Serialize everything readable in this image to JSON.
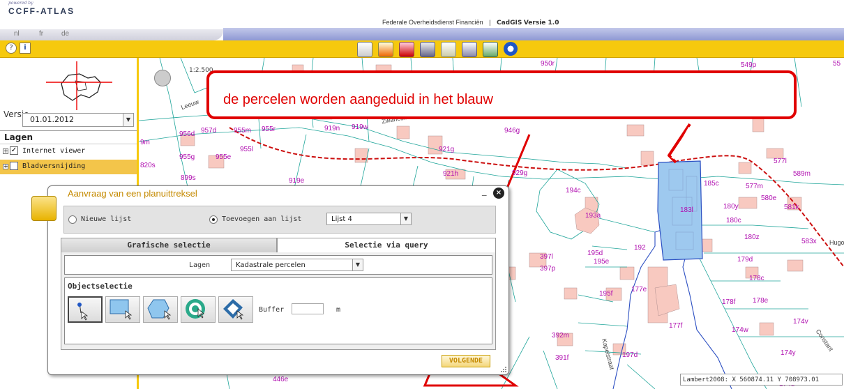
{
  "header": {
    "powered_by": "powered by",
    "logo": "CCFF-ATLAS",
    "title": "Federale Overheidsdienst Financiën",
    "app_name": "CadGIS",
    "version": "Versie 1.0",
    "separator": "|"
  },
  "languages": [
    "nl",
    "fr",
    "de"
  ],
  "toolbar": {
    "help_label": "?",
    "info_label": "i",
    "icons": [
      "layers-icon",
      "edit-icon",
      "measure-icon",
      "print-icon",
      "identify-icon",
      "search-parcel-icon",
      "search-address-icon",
      "info-icon"
    ]
  },
  "sidebar": {
    "versie_label": "Versie",
    "versie_value": "01.01.2012",
    "lagen_title": "Lagen",
    "layers": [
      {
        "label": "Internet viewer",
        "checked": true
      },
      {
        "label": "Bladversnijding",
        "checked": false
      }
    ]
  },
  "map": {
    "scale": "1:2.500",
    "parcels": [
      {
        "label": "956d"
      },
      {
        "label": "957d"
      },
      {
        "label": "955m"
      },
      {
        "label": "955r"
      },
      {
        "label": "919n"
      },
      {
        "label": "919w"
      },
      {
        "label": "946g"
      },
      {
        "label": "921g"
      },
      {
        "label": "921h"
      },
      {
        "label": "929g"
      },
      {
        "label": "955g"
      },
      {
        "label": "955e"
      },
      {
        "label": "955l"
      },
      {
        "label": "820s"
      },
      {
        "label": "899s"
      },
      {
        "label": "9m"
      },
      {
        "label": "919e"
      },
      {
        "label": "950r"
      },
      {
        "label": "549p"
      },
      {
        "label": "55"
      },
      {
        "label": "185c"
      },
      {
        "label": "194c"
      },
      {
        "label": "193a"
      },
      {
        "label": "183l"
      },
      {
        "label": "180y"
      },
      {
        "label": "180c"
      },
      {
        "label": "180z"
      },
      {
        "label": "577l"
      },
      {
        "label": "577m"
      },
      {
        "label": "589m"
      },
      {
        "label": "580e"
      },
      {
        "label": "581k"
      },
      {
        "label": "583x"
      },
      {
        "label": "195d"
      },
      {
        "label": "195e"
      },
      {
        "label": "192"
      },
      {
        "label": "397l"
      },
      {
        "label": "397p"
      },
      {
        "label": "179d"
      },
      {
        "label": "178c"
      },
      {
        "label": "195f"
      },
      {
        "label": "177e"
      },
      {
        "label": "178f"
      },
      {
        "label": "178e"
      },
      {
        "label": "174v"
      },
      {
        "label": "177f"
      },
      {
        "label": "174w"
      },
      {
        "label": "392m"
      },
      {
        "label": "391f"
      },
      {
        "label": "197d"
      },
      {
        "label": "174y"
      },
      {
        "label": "174d"
      },
      {
        "label": "446e"
      }
    ],
    "streets": [
      {
        "label": "Leeuw"
      },
      {
        "label": "Zwanestraat"
      },
      {
        "label": "Hugo"
      },
      {
        "label": "Kapelstraat"
      },
      {
        "label": "Constant"
      }
    ],
    "coords": "Lambert2008: X 560874.11 Y 708973.01"
  },
  "callout": {
    "text": "de percelen worden aangeduid in het blauw"
  },
  "dialog": {
    "title": "Aanvraag van een planuittreksel",
    "minimize": "_",
    "close": "×",
    "radio_new": "Nieuwe lijst",
    "radio_add": "Toevoegen aan lijst",
    "lijst_value": "Lijst 4",
    "tab_graphic": "Grafische selectie",
    "tab_query": "Selectie via query",
    "lagen_label": "Lagen",
    "lagen_value": "Kadastrale percelen",
    "objectselectie": "Objectselectie",
    "buffer_label": "Buffer",
    "buffer_unit": "m",
    "next_button": "VOLGENDE",
    "tools": [
      "point-select-icon",
      "rectangle-select-icon",
      "polygon-select-icon",
      "circle-select-icon",
      "line-select-icon"
    ]
  },
  "colors": {
    "toolbar": "#f6c90e",
    "callout": "#e00000",
    "parcel_label": "#b010b0",
    "selection": "#9ec9ef"
  }
}
